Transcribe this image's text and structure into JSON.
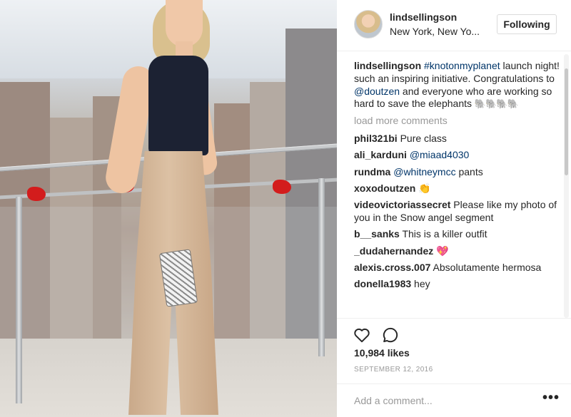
{
  "post": {
    "username": "lindsellingson",
    "location": "New York, New Yo...",
    "follow_label": "Following",
    "caption": {
      "username": "lindsellingson",
      "hashtag": "#knotonmyplanet",
      "text_a": " launch night! such an inspiring initiative. Congratulations to ",
      "mention": "@doutzen",
      "text_b": " and everyone who are working so hard to save the elephants ",
      "emoji": "🐘🐘🐘🐘"
    },
    "load_more": "load more comments",
    "comments": [
      {
        "user": "phil321bi",
        "text": "Pure class"
      },
      {
        "user": "ali_karduni",
        "mention": "@miaad4030",
        "text": ""
      },
      {
        "user": "rundma",
        "mention": "@whitneymcc",
        "text": " pants"
      },
      {
        "user": "xoxodoutzen",
        "text": "👏"
      },
      {
        "user": "videovictoriassecret",
        "text": "Please like my photo of you in the Snow angel segment"
      },
      {
        "user": "b__sanks",
        "text": "This is a killer outfit"
      },
      {
        "user": "_dudahernandez",
        "text": "💖"
      },
      {
        "user": "alexis.cross.007",
        "text": "Absolutamente hermosa"
      },
      {
        "user": "donella1983",
        "text": "hey"
      }
    ],
    "likes": "10,984 likes",
    "date": "SEPTEMBER 12, 2016",
    "add_comment_placeholder": "Add a comment...",
    "more_options": "•••",
    "icons": {
      "like": "heart-icon",
      "comment": "comment-bubble-icon",
      "options": "more-options-icon"
    }
  },
  "colors": {
    "mention": "#003569",
    "muted": "#999999",
    "border": "#efefef",
    "text": "#262626"
  }
}
